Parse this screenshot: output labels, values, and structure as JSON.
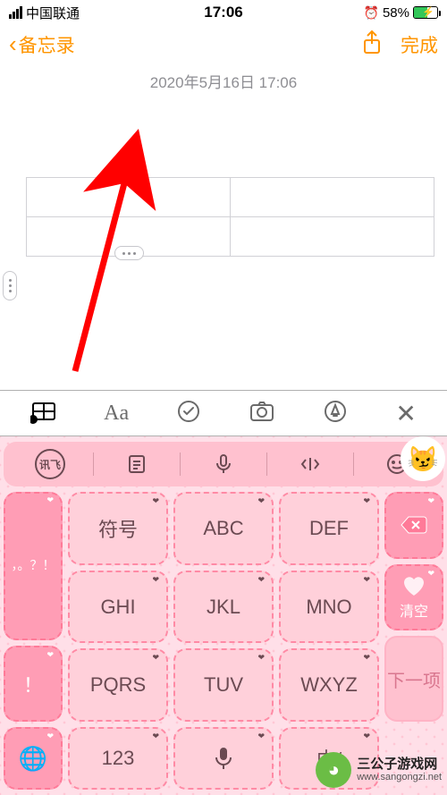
{
  "status": {
    "carrier": "中国联通",
    "time": "17:06",
    "alarm_icon": "⏰",
    "battery_pct": "58%"
  },
  "nav": {
    "back_label": "备忘录",
    "share_icon": "share",
    "done_label": "完成"
  },
  "note": {
    "timestamp": "2020年5月16日 17:06"
  },
  "toolbar": {
    "table_icon": "table",
    "text_style": "Aa",
    "check_icon": "check",
    "camera_icon": "camera",
    "draw_icon": "draw",
    "close_label": "✕"
  },
  "keyboard": {
    "suggest": {
      "logo": "讯飞",
      "clipboard_icon": "clipboard",
      "mic_icon": "mic",
      "code_icon": "code",
      "emoji_icon": "emoji"
    },
    "side_left": {
      "punct_top": "，。？！",
      "punct_bottom": "！",
      "globe_icon": "globe"
    },
    "keys": {
      "r1c1": "符号",
      "r1c2": "ABC",
      "r1c3": "DEF",
      "r2c1": "GHI",
      "r2c2": "JKL",
      "r2c3": "MNO",
      "r3c1": "PQRS",
      "r3c2": "TUV",
      "r3c3": "WXYZ",
      "r4c1": "123",
      "r4c3": "中/"
    },
    "side_right": {
      "delete_icon": "delete",
      "clear_label": "清空",
      "next_label": "下一项"
    }
  },
  "watermark": {
    "title": "三公子游戏网",
    "domain": "www.sangongzi.net"
  }
}
